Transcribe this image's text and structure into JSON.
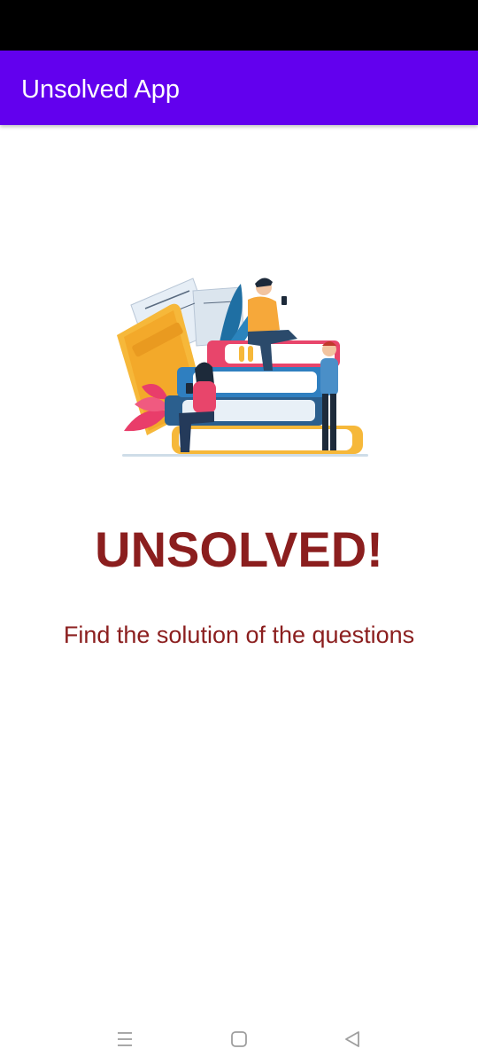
{
  "app_bar": {
    "title": "Unsolved App"
  },
  "main": {
    "headline": "UNSOLVED!",
    "subtitle": "Find the solution of the questions",
    "illustration": "people-reading-on-books-illustration"
  },
  "nav_bar": {
    "items": [
      "recent-apps-icon",
      "home-icon",
      "back-icon"
    ]
  },
  "colors": {
    "app_bar": "#6200ee",
    "status_bar": "#000000",
    "headline_text": "#8b1e1e",
    "title_text": "#ffffff"
  }
}
